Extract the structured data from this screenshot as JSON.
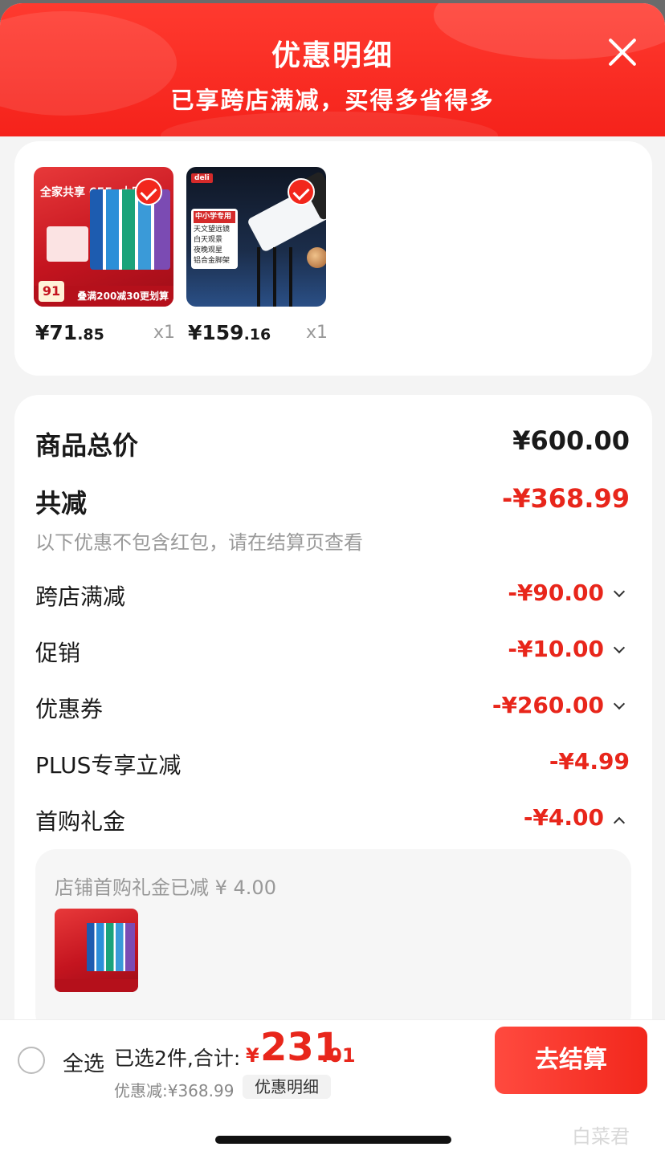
{
  "header": {
    "title": "优惠明细",
    "subtitle": "已享跨店满减，买得多省得多"
  },
  "products": [
    {
      "image": "toothpaste-product",
      "tag": "全家共享 655g大容量",
      "badge_price": "91",
      "banner": "叠满200减30更划算",
      "price_int": "¥71",
      "price_dec": ".85",
      "qty": "x1",
      "checked": true
    },
    {
      "image": "telescope-product",
      "brand": "deli",
      "label_header": "中小学专用",
      "label_lines": [
        "天文望远镜",
        "白天观景",
        "夜晚观星",
        "铝合金脚架"
      ],
      "price_int": "¥159",
      "price_dec": ".16",
      "qty": "x1",
      "checked": true
    }
  ],
  "summary": {
    "total_label": "商品总价",
    "total_value": "¥600.00",
    "reduced_label": "共减",
    "reduced_value": "-¥368.99",
    "note": "以下优惠不包含红包，请在结算页查看",
    "lines": [
      {
        "label": "跨店满减",
        "value": "-¥90.00",
        "expand": "down"
      },
      {
        "label": "促销",
        "value": "-¥10.00",
        "expand": "down"
      },
      {
        "label": "优惠券",
        "value": "-¥260.00",
        "expand": "down"
      },
      {
        "label": "PLUS专享立减",
        "value": "-¥4.99",
        "expand": "none"
      },
      {
        "label": "首购礼金",
        "value": "-¥4.00",
        "expand": "up"
      }
    ],
    "gift_detail": "店铺首购礼金已减 ¥ 4.00"
  },
  "bottom_bar": {
    "select_all": "全选",
    "selected": "已选2件,合计:",
    "total_yen": "¥",
    "total_int": "231",
    "total_dec": ".01",
    "discount": "优惠减:¥368.99",
    "detail_chip": "优惠明细",
    "checkout": "去结算"
  },
  "watermark": "白菜君",
  "colors": {
    "accent_red": "#f2271c",
    "price_red": "#e8261b",
    "background": "#f4f4f4"
  }
}
